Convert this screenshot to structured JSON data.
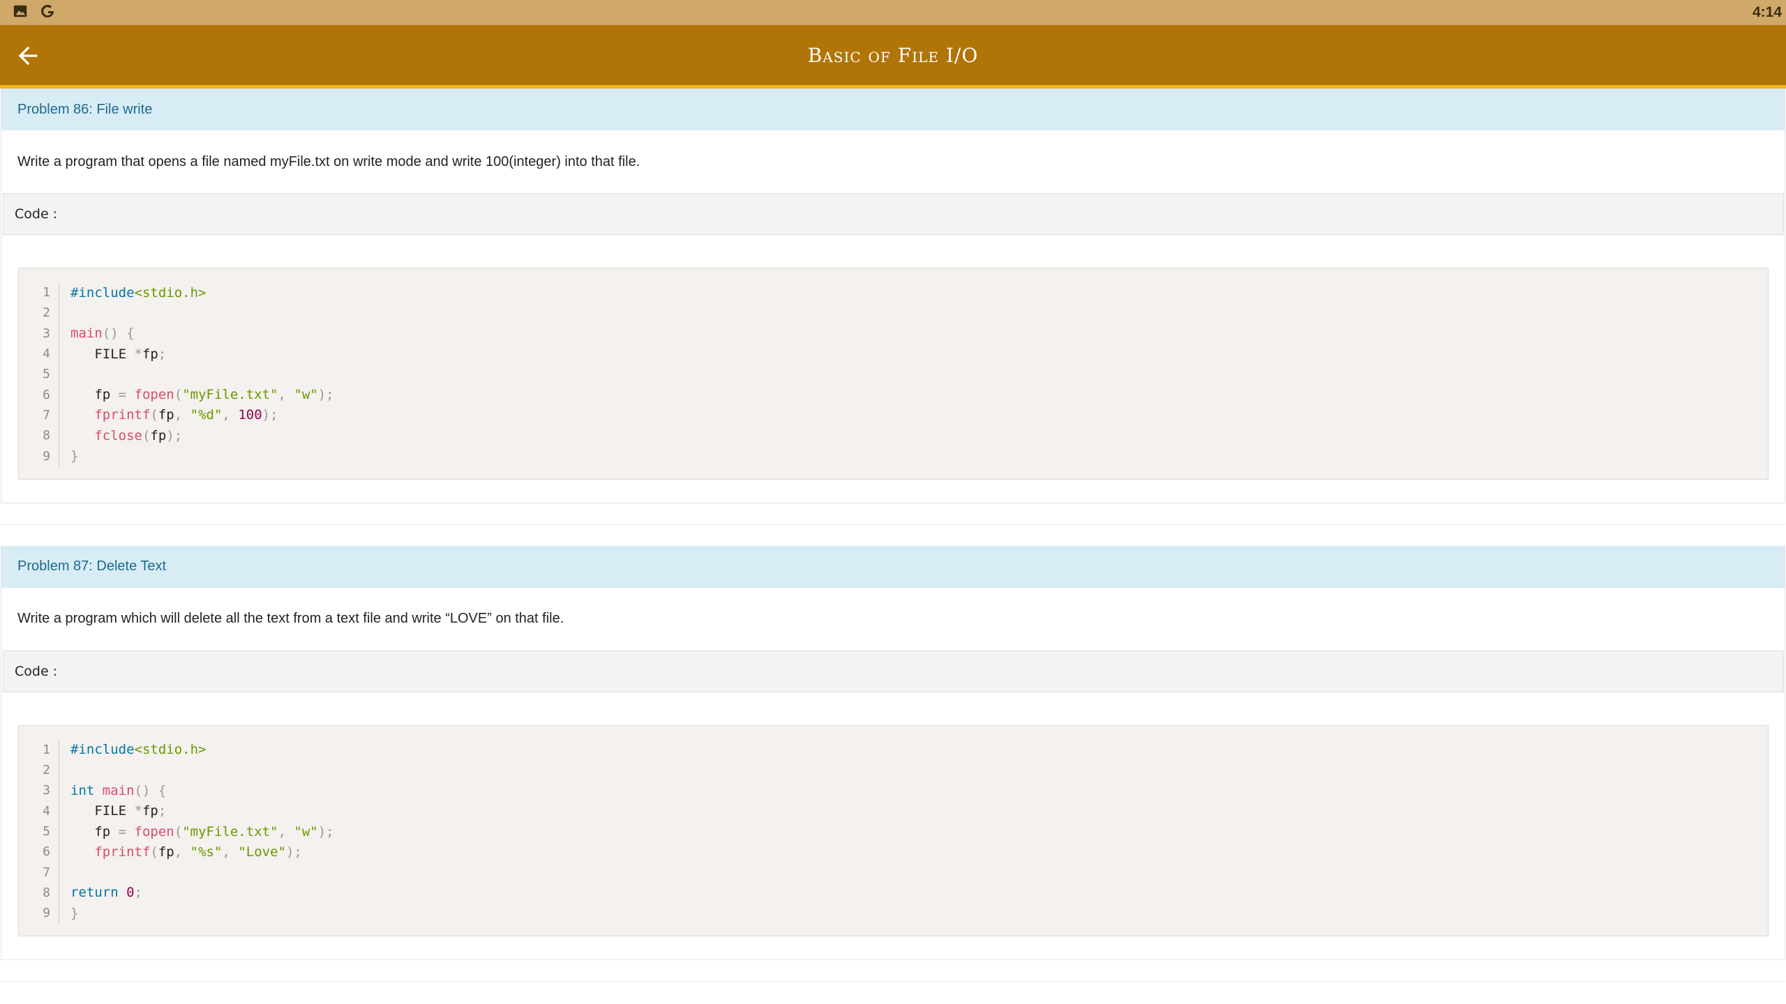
{
  "status": {
    "time": "4:14"
  },
  "app_bar": {
    "title": "Basic of File I/O"
  },
  "problems": [
    {
      "title": "Problem 86: File write",
      "description": "Write a program that opens a file named myFile.txt on write mode and write 100(integer) into that file.",
      "code_label": "Code :",
      "code": [
        {
          "n": "1",
          "text": "#include<stdio.h>"
        },
        {
          "n": "2",
          "text": ""
        },
        {
          "n": "3",
          "text": "main() {"
        },
        {
          "n": "4",
          "text": "   FILE *fp;"
        },
        {
          "n": "5",
          "text": ""
        },
        {
          "n": "6",
          "text": "   fp = fopen(\"myFile.txt\", \"w\");"
        },
        {
          "n": "7",
          "text": "   fprintf(fp, \"%d\", 100);"
        },
        {
          "n": "8",
          "text": "   fclose(fp);"
        },
        {
          "n": "9",
          "text": "}"
        }
      ]
    },
    {
      "title": "Problem 87: Delete Text",
      "description": "Write a program which will delete all the text from a text file and write “LOVE” on that file.",
      "code_label": "Code :",
      "code": [
        {
          "n": "1",
          "text": "#include<stdio.h>"
        },
        {
          "n": "2",
          "text": ""
        },
        {
          "n": "3",
          "text": "int main() {"
        },
        {
          "n": "4",
          "text": "   FILE *fp;"
        },
        {
          "n": "5",
          "text": "   fp = fopen(\"myFile.txt\", \"w\");"
        },
        {
          "n": "6",
          "text": "   fprintf(fp, \"%s\", \"Love\");"
        },
        {
          "n": "7",
          "text": ""
        },
        {
          "n": "8",
          "text": "return 0;"
        },
        {
          "n": "9",
          "text": "}"
        }
      ]
    }
  ]
}
